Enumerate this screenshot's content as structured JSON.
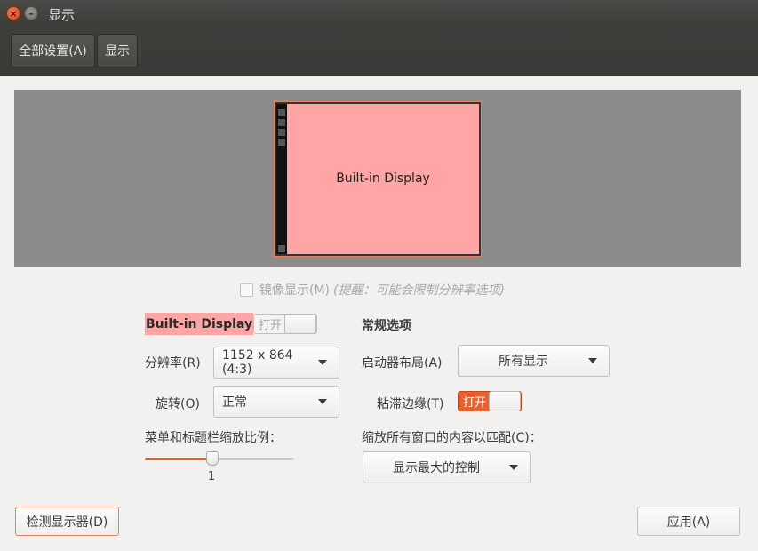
{
  "window": {
    "title": "显示"
  },
  "toolbar": {
    "all_settings_label": "全部设置(A)",
    "display_label": "显示"
  },
  "preview": {
    "monitor_label": "Built-in Display"
  },
  "mirror": {
    "label": "镜像显示(M)",
    "hint": "(提醒：可能会限制分辨率选项)",
    "checked": false
  },
  "monitor_settings": {
    "display_name": "Built-in Display",
    "power_switch_label": "打开",
    "power_switch_on": false,
    "resolution_label": "分辨率(R)",
    "resolution_value": "1152 x 864 (4:3)",
    "rotation_label": "旋转(O)",
    "rotation_value": "正常",
    "scale_label": "菜单和标题栏缩放比例：",
    "scale_value": "1",
    "scale_fraction": 0.45
  },
  "general": {
    "heading": "常规选项",
    "launcher_label": "启动器布局(A)",
    "launcher_value": "所有显示",
    "sticky_label": "粘滞边缘(T)",
    "sticky_switch_label": "打开",
    "sticky_on": true,
    "scale_windows_label": "缩放所有窗口的内容以匹配(C)：",
    "scale_windows_value": "显示最大的控制"
  },
  "buttons": {
    "detect_label": "检测显示器(D)",
    "apply_label": "应用(A)"
  },
  "colors": {
    "accent": "#e7602d",
    "monitor_fill": "#ffa5a5",
    "titlebar": "#3d3c39"
  }
}
